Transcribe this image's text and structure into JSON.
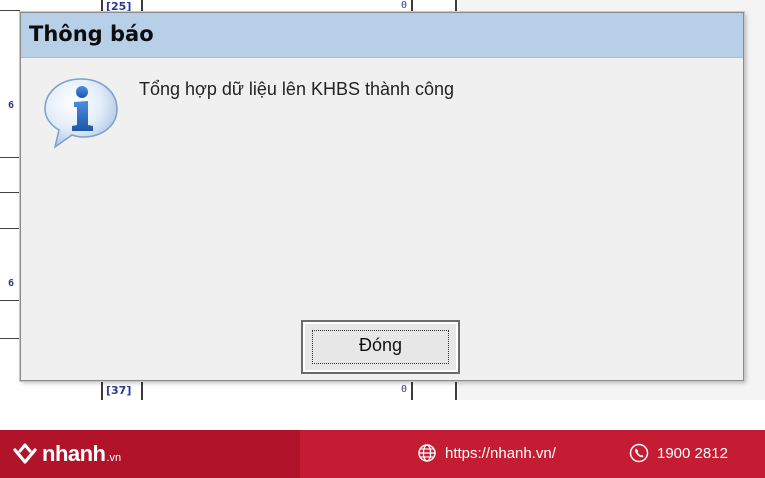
{
  "background": {
    "top_cell": "[25]",
    "bottom_cell": "[37]",
    "zero_top": "0",
    "zero_bottom": "0",
    "row_mark_1": "6",
    "row_mark_2": "6"
  },
  "dialog": {
    "title": "Thông báo",
    "icon": "info-icon",
    "message": "Tổng hợp dữ liệu lên KHBS thành công",
    "button_label_before": "Đón",
    "button_label_underlined": "g"
  },
  "footer": {
    "brand": "nhanh",
    "brand_suffix": ".vn",
    "website": "https://nhanh.vn/",
    "phone": "1900 2812",
    "colors": {
      "bar": "#c41d33",
      "text": "#ffffff"
    }
  },
  "colors": {
    "titlebar": "#b8cfe8",
    "dialog_bg": "#f0f0f0",
    "icon_blue": "#2f6fc1"
  }
}
